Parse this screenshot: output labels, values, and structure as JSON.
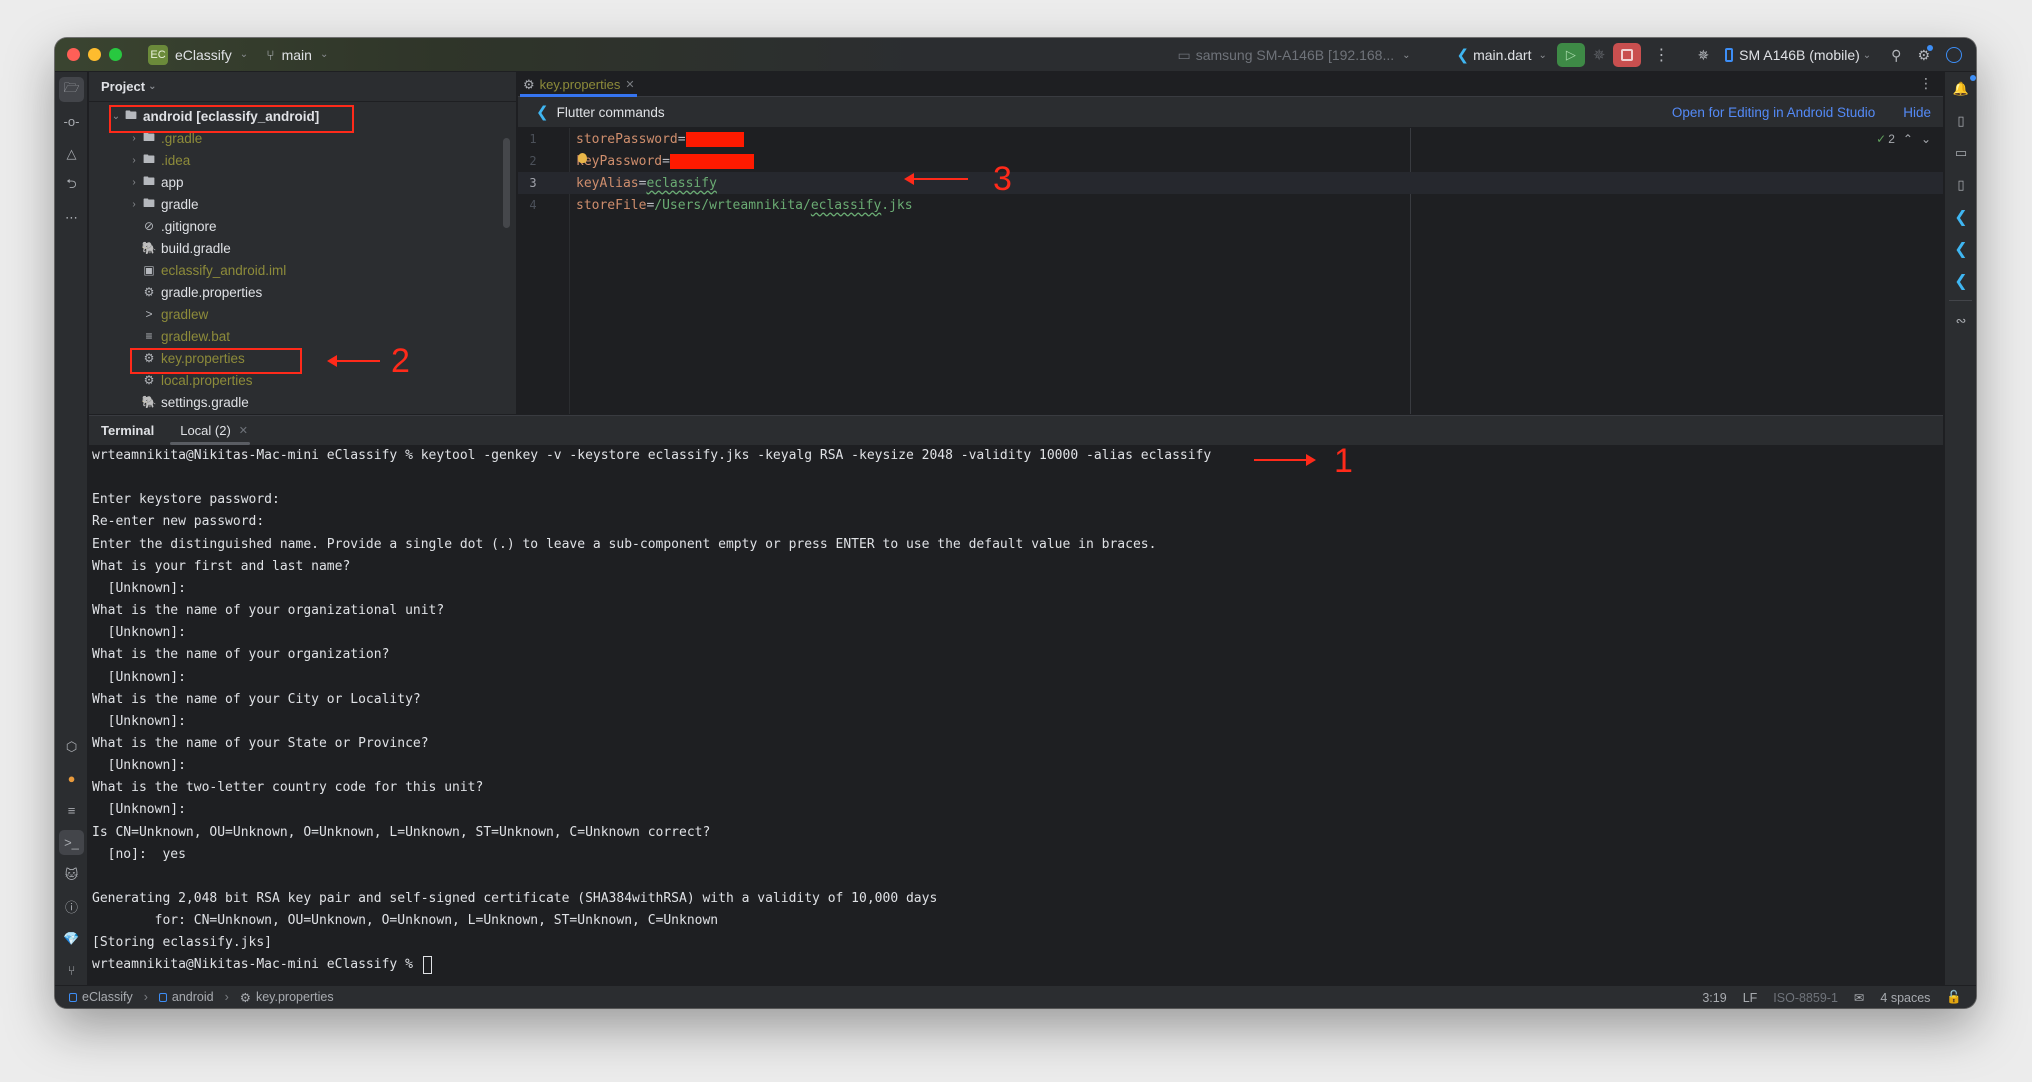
{
  "titlebar": {
    "project_badge": "EC",
    "project_name": "eClassify",
    "branch": "main",
    "device_selector": "samsung SM-A146B [192.168...",
    "run_config": "main.dart",
    "device": "SM A146B (mobile)"
  },
  "project_panel": {
    "title": "Project",
    "tree": [
      {
        "label": "android [eclassify_android]",
        "type": "folder",
        "expanded": true,
        "depth": 0,
        "ignored": false,
        "bold": true
      },
      {
        "label": ".gradle",
        "type": "folder",
        "expanded": false,
        "depth": 1,
        "ignored": true
      },
      {
        "label": ".idea",
        "type": "folder-config",
        "expanded": false,
        "depth": 1,
        "ignored": true
      },
      {
        "label": "app",
        "type": "folder",
        "expanded": false,
        "depth": 1,
        "ignored": false
      },
      {
        "label": "gradle",
        "type": "folder",
        "expanded": false,
        "depth": 1,
        "ignored": false
      },
      {
        "label": ".gitignore",
        "type": "ignore-file",
        "depth": 1,
        "ignored": false
      },
      {
        "label": "build.gradle",
        "type": "gradle-file",
        "depth": 1,
        "ignored": false
      },
      {
        "label": "eclassify_android.iml",
        "type": "iml-file",
        "depth": 1,
        "ignored": true
      },
      {
        "label": "gradle.properties",
        "type": "properties-file",
        "depth": 1,
        "ignored": false
      },
      {
        "label": "gradlew",
        "type": "shell-file",
        "depth": 1,
        "ignored": true
      },
      {
        "label": "gradlew.bat",
        "type": "text-file",
        "depth": 1,
        "ignored": true
      },
      {
        "label": "key.properties",
        "type": "properties-file",
        "depth": 1,
        "ignored": true
      },
      {
        "label": "local.properties",
        "type": "properties-file",
        "depth": 1,
        "ignored": true
      },
      {
        "label": "settings.gradle",
        "type": "gradle-file",
        "depth": 1,
        "ignored": false
      }
    ]
  },
  "editor": {
    "tab_label": "key.properties",
    "banner_title": "Flutter commands",
    "banner_link_open": "Open for Editing in Android Studio",
    "banner_link_hide": "Hide",
    "inspection_count": "2",
    "current_line": 3,
    "lines": [
      {
        "num": "1",
        "key": "storePassword",
        "eq": "=",
        "value": "",
        "redacted": true
      },
      {
        "num": "2",
        "key": "keyPassword",
        "eq": "=",
        "value": "",
        "redacted": true
      },
      {
        "num": "3",
        "key": "keyAlias",
        "eq": "=",
        "value": "eclassify",
        "redacted": false
      },
      {
        "num": "4",
        "key": "storeFile",
        "eq": "=",
        "value": "/Users/wrteamnikita/eclassify.jks",
        "redacted": false
      }
    ]
  },
  "terminal": {
    "title": "Terminal",
    "tab_label": "Local (2)",
    "lines": [
      "wrteamnikita@Nikitas-Mac-mini eClassify % keytool -genkey -v -keystore eclassify.jks -keyalg RSA -keysize 2048 -validity 10000 -alias eclassify",
      "",
      "Enter keystore password:",
      "Re-enter new password:",
      "Enter the distinguished name. Provide a single dot (.) to leave a sub-component empty or press ENTER to use the default value in braces.",
      "What is your first and last name?",
      "  [Unknown]:",
      "What is the name of your organizational unit?",
      "  [Unknown]:",
      "What is the name of your organization?",
      "  [Unknown]:",
      "What is the name of your City or Locality?",
      "  [Unknown]:",
      "What is the name of your State or Province?",
      "  [Unknown]:",
      "What is the two-letter country code for this unit?",
      "  [Unknown]:",
      "Is CN=Unknown, OU=Unknown, O=Unknown, L=Unknown, ST=Unknown, C=Unknown correct?",
      "  [no]:  yes",
      "",
      "Generating 2,048 bit RSA key pair and self-signed certificate (SHA384withRSA) with a validity of 10,000 days",
      "        for: CN=Unknown, OU=Unknown, O=Unknown, L=Unknown, ST=Unknown, C=Unknown",
      "[Storing eclassify.jks]",
      "wrteamnikita@Nikitas-Mac-mini eClassify % "
    ]
  },
  "statusbar": {
    "breadcrumb": [
      "eClassify",
      "android",
      "key.properties"
    ],
    "position": "3:19",
    "line_separator": "LF",
    "encoding": "ISO-8859-1",
    "indent": "4 spaces"
  },
  "annotations": {
    "step1": "1",
    "step2": "2",
    "step3": "3",
    "color": "#ff2a1a"
  }
}
